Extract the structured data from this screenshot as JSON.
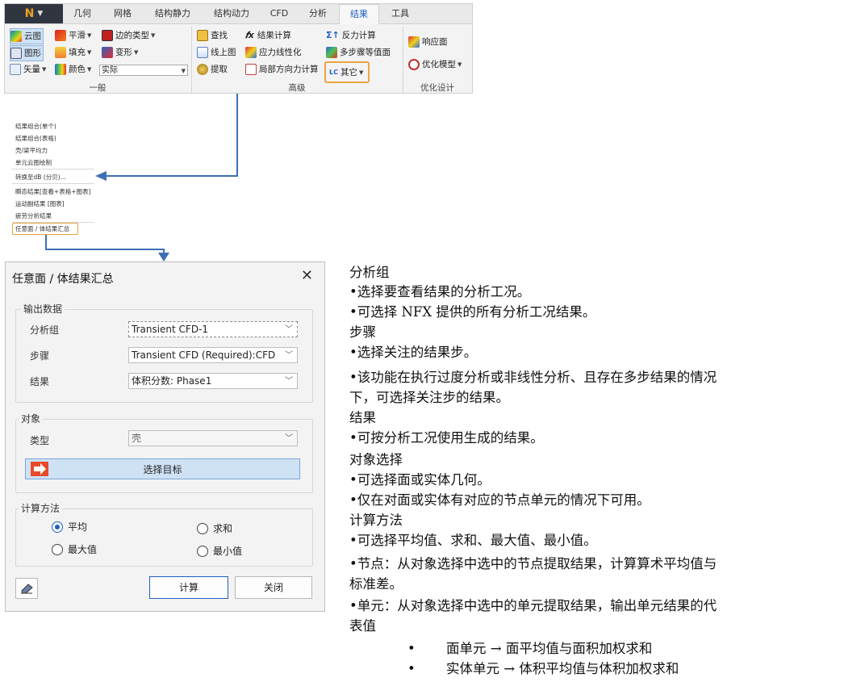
{
  "ribbon": {
    "tabs": [
      "几何",
      "网格",
      "结构静力",
      "结构动力",
      "CFD",
      "分析",
      "结果",
      "工具"
    ],
    "active_tab": "结果",
    "general": {
      "contour": "云图",
      "smooth": "平滑",
      "edge_type": "边的类型",
      "graph": "图形",
      "fill": "填充",
      "deform": "变形",
      "vector": "矢量",
      "color": "颜色",
      "actual_value": "实际",
      "group_label": "一般"
    },
    "advanced": {
      "find": "查找",
      "result_calc": "结果计算",
      "reaction_calc": "反力计算",
      "online_graph": "线上图",
      "stress_linearize": "应力线性化",
      "multistep_equal": "多步骤等值面",
      "extract": "提取",
      "local_dir_force": "局部方向力计算",
      "other": "其它",
      "group_label": "高级"
    },
    "optimize": {
      "response_surface": "响应面",
      "optimize_model": "优化模型",
      "group_label": "优化设计"
    }
  },
  "menu": {
    "items_group1": [
      "结果组合(单个)",
      "结果组合(表格)",
      "壳/梁平均力",
      "单元云图绘制"
    ],
    "items_group2": [
      "转换至dB (分贝)..."
    ],
    "items_group3": [
      "瞬态结果[查看+表格+图表]",
      "运动副结果 [图表]",
      "疲劳分析结果"
    ],
    "highlight": "任意面 / 体结果汇总"
  },
  "dialog": {
    "title": "任意面 / 体结果汇总",
    "output_section": {
      "legend": "输出数据",
      "analysis_group_label": "分析组",
      "analysis_group_value": "Transient CFD-1",
      "step_label": "步骤",
      "step_value": "Transient CFD (Required):CFD",
      "result_label": "结果",
      "result_value": "体积分数: Phase1"
    },
    "object_section": {
      "legend": "对象",
      "type_label": "类型",
      "type_value": "壳",
      "select_target": "选择目标"
    },
    "calc_section": {
      "legend": "计算方法",
      "average": "平均",
      "sum": "求和",
      "max": "最大值",
      "min": "最小值",
      "selected": "平均"
    },
    "calc_button": "计算",
    "close_button": "关闭"
  },
  "description": [
    "分析组",
    "•选择要查看结果的分析工况。",
    "•可选择 NFX 提供的所有分析工况结果。",
    "步骤",
    "•选择关注的结果步。",
    "•该功能在执行过度分析或非线性分析、且存在多步结果的情况",
    "下，可选择关注步的结果。",
    "结果",
    "•可按分析工况使用生成的结果。",
    "对象选择",
    "•可选择面或实体几何。",
    "•仅在对面或实体有对应的节点单元的情况下可用。",
    "计算方法",
    "•可选择平均值、求和、最大值、最小值。",
    "•节点：从对象选择中选中的节点提取结果，计算算术平均值与",
    "标准差。",
    "•单元：从对象选择中选中的单元提取结果，输出单元结果的代",
    "表值"
  ],
  "bullets": [
    {
      "marker": "•",
      "text": "面单元 → 面平均值与面积加权求和"
    },
    {
      "marker": "•",
      "text": "实体单元 → 体积平均值与体积加权求和"
    }
  ],
  "colors": {
    "accent": "#3d6fb4",
    "highlight_border": "#e8a640",
    "select_button": "#cfe2f5"
  }
}
